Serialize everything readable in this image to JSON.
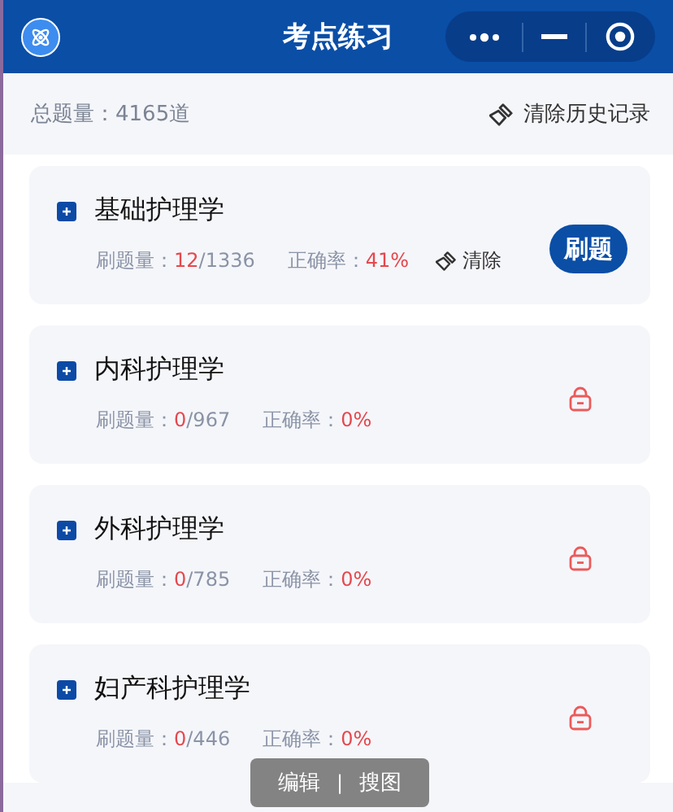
{
  "header": {
    "title": "考点练习"
  },
  "summary": {
    "total_label": "总题量：",
    "total_value": "4165道",
    "clear_history": "清除历史记录"
  },
  "subjects": [
    {
      "name": "基础护理学",
      "count_label": "刷题量：",
      "done": "12",
      "total": "/1336",
      "accuracy_label": "正确率：",
      "accuracy": "41%",
      "locked": false,
      "clear_label": "清除",
      "action": "刷题"
    },
    {
      "name": "内科护理学",
      "count_label": "刷题量：",
      "done": "0",
      "total": "/967",
      "accuracy_label": "正确率：",
      "accuracy": "0%",
      "locked": true
    },
    {
      "name": "外科护理学",
      "count_label": "刷题量：",
      "done": "0",
      "total": "/785",
      "accuracy_label": "正确率：",
      "accuracy": "0%",
      "locked": true
    },
    {
      "name": "妇产科护理学",
      "count_label": "刷题量：",
      "done": "0",
      "total": "/446",
      "accuracy_label": "正确率：",
      "accuracy": "0%",
      "locked": true
    }
  ],
  "overlay": {
    "items": [
      "编辑",
      "搜图"
    ],
    "separator": "|"
  }
}
